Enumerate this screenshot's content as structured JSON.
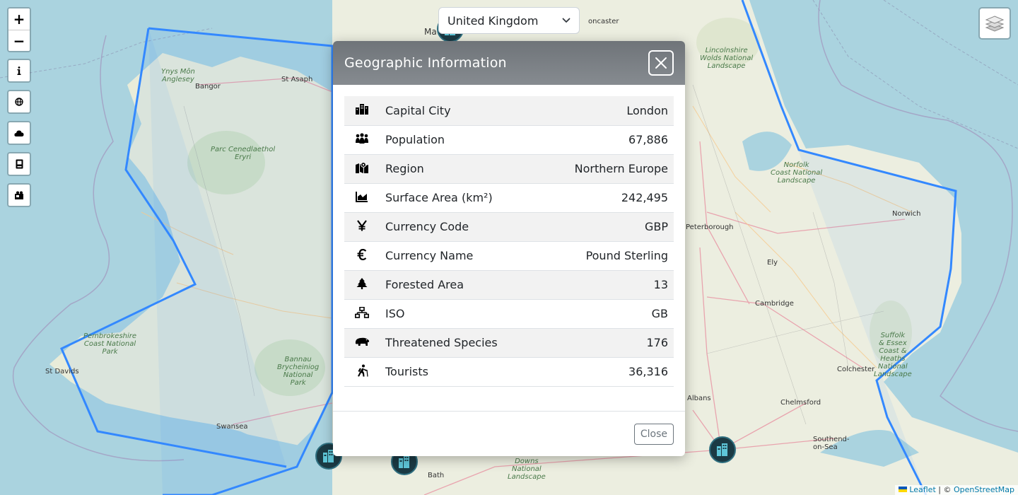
{
  "map": {
    "places": [
      {
        "name": "Ynys Môn\nAnglesey",
        "kind": "park"
      },
      {
        "name": "Bangor",
        "kind": "city"
      },
      {
        "name": "St Asaph",
        "kind": "city"
      },
      {
        "name": "Parc Cenedlaethol\nEryri",
        "kind": "park"
      },
      {
        "name": "Pembrokeshire\nCoast National\nPark",
        "kind": "park"
      },
      {
        "name": "St Davids",
        "kind": "city"
      },
      {
        "name": "Bannau\nBrycheiniog\nNational\nPark",
        "kind": "park"
      },
      {
        "name": "Swansea",
        "kind": "city"
      },
      {
        "name": "Lincolnshire\nWolds National\nLandscape",
        "kind": "park"
      },
      {
        "name": "Norfolk\nCoast National\nLandscape",
        "kind": "park"
      },
      {
        "name": "Norwich",
        "kind": "city"
      },
      {
        "name": "Peterborough",
        "kind": "city"
      },
      {
        "name": "Ely",
        "kind": "city"
      },
      {
        "name": "Cambridge",
        "kind": "city"
      },
      {
        "name": "Suffolk\n& Essex\nCoast &\nHeaths\nNational\nLandscape",
        "kind": "park"
      },
      {
        "name": "Colchester",
        "kind": "city"
      },
      {
        "name": "Chelmsford",
        "kind": "city"
      },
      {
        "name": "Southend-\non-Sea",
        "kind": "city"
      },
      {
        "name": "Albans",
        "kind": "city"
      },
      {
        "name": "Downs\nNational\nLandscape",
        "kind": "park"
      },
      {
        "name": "Bath",
        "kind": "city"
      },
      {
        "name": "Ma",
        "kind": "city"
      },
      {
        "name": "oncaster",
        "kind": "city"
      }
    ]
  },
  "controls": {
    "zoom_in": "+",
    "zoom_out": "−",
    "easy_buttons": [
      {
        "name": "info-button",
        "icon": "info-icon",
        "glyph": "i"
      },
      {
        "name": "globe-button",
        "icon": "globe-icon",
        "glyph": "🌐"
      },
      {
        "name": "weather-button",
        "icon": "cloud-icon",
        "glyph": "☁"
      },
      {
        "name": "wikipedia-button",
        "icon": "book-icon",
        "glyph": "📔"
      },
      {
        "name": "news-button",
        "icon": "news-icon",
        "glyph": "📰"
      }
    ],
    "layers_icon": "layers-icon"
  },
  "country_select": {
    "selected": "United Kingdom",
    "icon": "chevron-down-icon"
  },
  "modal": {
    "title": "Geographic Information",
    "close_icon": "close-icon",
    "close_label": "Close",
    "rows": [
      {
        "icon": "city-icon",
        "label": "Capital City",
        "value": "London"
      },
      {
        "icon": "people-icon",
        "label": "Population",
        "value": "67,886"
      },
      {
        "icon": "map-marker-icon",
        "label": "Region",
        "value": "Northern Europe"
      },
      {
        "icon": "area-chart-icon",
        "label": "Surface Area (km²)",
        "value": "242,495"
      },
      {
        "icon": "yen-icon",
        "label": "Currency Code",
        "value": "GBP"
      },
      {
        "icon": "euro-icon",
        "label": "Currency Name",
        "value": "Pound Sterling"
      },
      {
        "icon": "tree-icon",
        "label": "Forested Area",
        "value": "13"
      },
      {
        "icon": "sitemap-icon",
        "label": "ISO",
        "value": "GB"
      },
      {
        "icon": "hippo-icon",
        "label": "Threatened Species",
        "value": "176"
      },
      {
        "icon": "hiking-icon",
        "label": "Tourists",
        "value": "36,316"
      }
    ]
  },
  "attribution": {
    "leaflet": "Leaflet",
    "separator": " | © ",
    "osm": "OpenStreetMap"
  },
  "colors": {
    "sea": "#aad3df",
    "land": "#f2efe9",
    "border": "#3388ff",
    "header": "#7a7f84"
  }
}
